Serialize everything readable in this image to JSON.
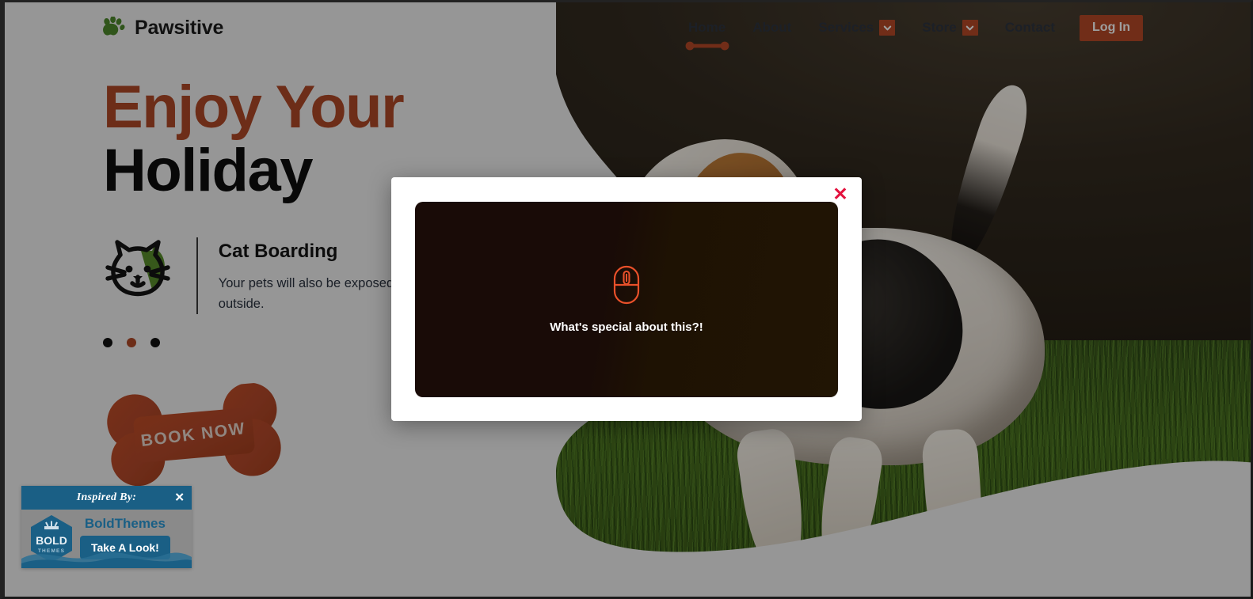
{
  "header": {
    "brand": {
      "logo_icon": "paw-print-icon",
      "name": "Pawsitive",
      "logo_color": "#4e8a2c"
    },
    "nav": [
      {
        "label": "Home",
        "active": true,
        "has_dropdown": false
      },
      {
        "label": "About",
        "active": false,
        "has_dropdown": false
      },
      {
        "label": "Services",
        "active": false,
        "has_dropdown": true
      },
      {
        "label": "Store",
        "active": false,
        "has_dropdown": true
      },
      {
        "label": "Contact",
        "active": false,
        "has_dropdown": false
      }
    ],
    "login_label": "Log In",
    "accent_color": "#b74a28"
  },
  "hero": {
    "heading_line1": "Enjoy Your",
    "heading_line2": "Holiday",
    "feature": {
      "icon": "cat-face-icon",
      "title": "Cat Boarding",
      "description": "Your pets will also be exposed to  interaction, time outside."
    },
    "carousel": {
      "total": 3,
      "active_index": 1
    },
    "cta_label": "BOOK NOW"
  },
  "modal": {
    "close_label": "✕",
    "close_color": "#e3123e",
    "media": {
      "icon": "computer-mouse-icon",
      "caption": "What's special about this?!",
      "icon_color": "#e8502a"
    }
  },
  "bold_themes_badge": {
    "header_title": "Inspired By:",
    "close_label": "✕",
    "logo_text_top": "BOLD",
    "logo_text_bottom": "THEMES",
    "name": "BoldThemes",
    "cta_label": "Take A Look!",
    "brand_color": "#1a5f85"
  }
}
